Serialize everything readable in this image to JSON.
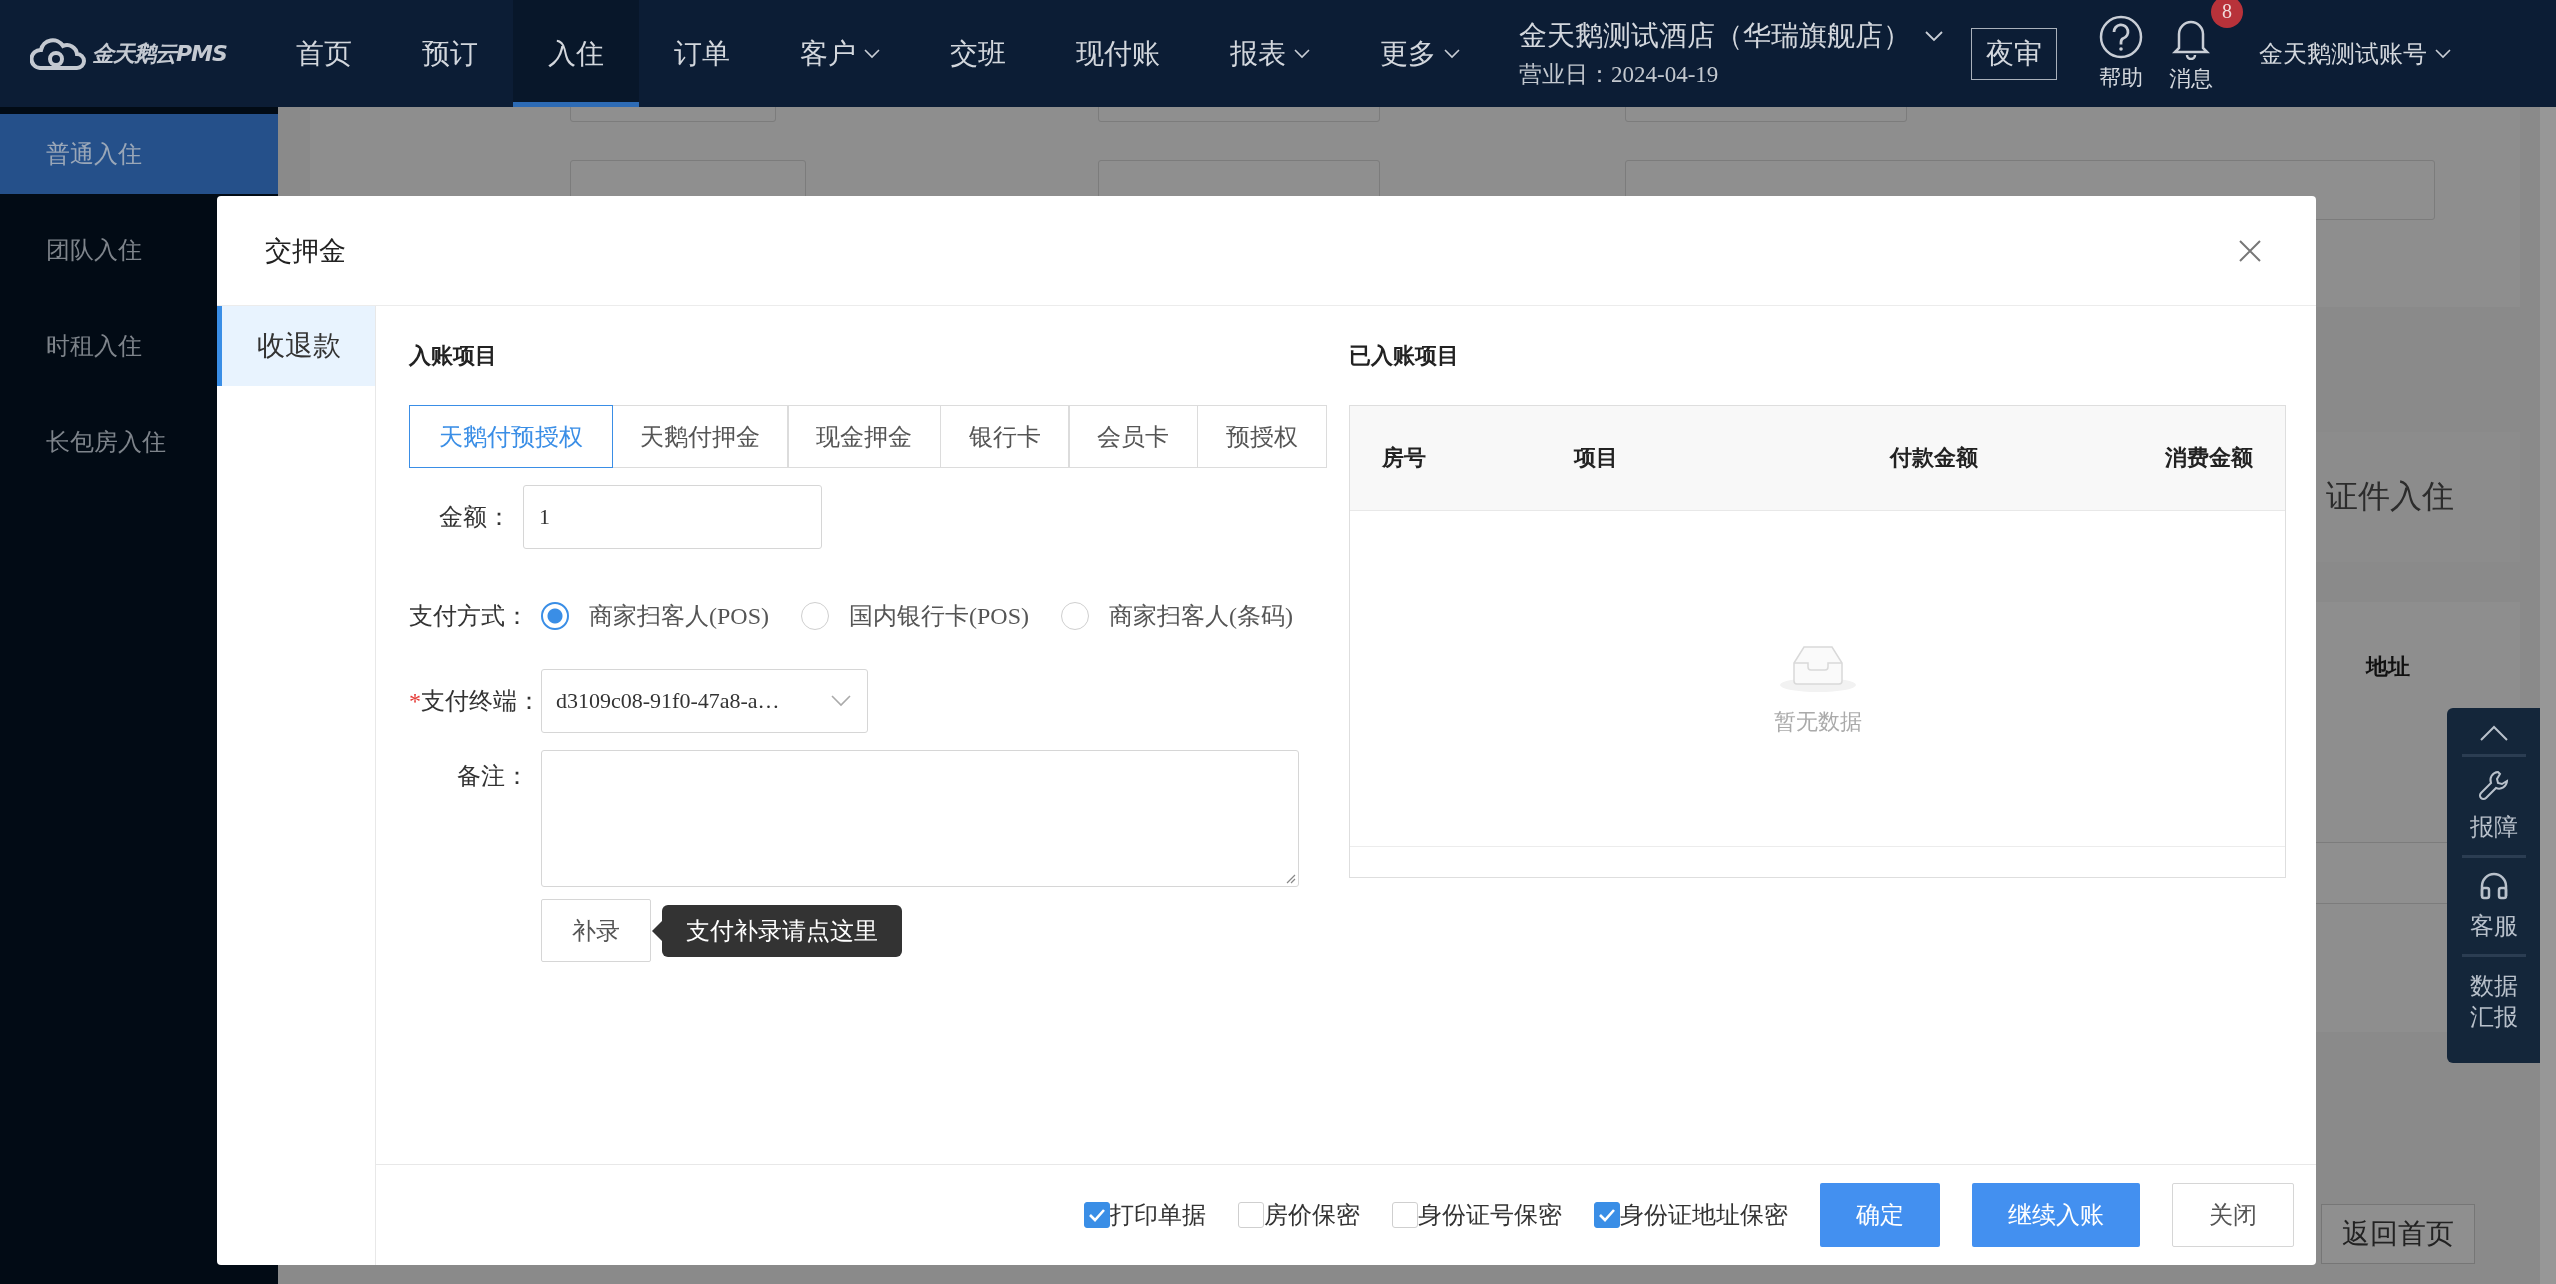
{
  "top_nav": {
    "logo": "金天鹅云PMS",
    "items": [
      {
        "label": "首页",
        "selected": false,
        "dropdown": false
      },
      {
        "label": "预订",
        "selected": false,
        "dropdown": false
      },
      {
        "label": "入住",
        "selected": true,
        "dropdown": false
      },
      {
        "label": "订单",
        "selected": false,
        "dropdown": false
      },
      {
        "label": "客户",
        "selected": false,
        "dropdown": true
      },
      {
        "label": "交班",
        "selected": false,
        "dropdown": false
      },
      {
        "label": "现付账",
        "selected": false,
        "dropdown": false
      },
      {
        "label": "报表",
        "selected": false,
        "dropdown": true
      },
      {
        "label": "更多",
        "selected": false,
        "dropdown": true
      }
    ],
    "hotel": {
      "name": "金天鹅测试酒店（华瑞旗舰店）",
      "business_day": "营业日：2024-04-19"
    },
    "night_audit_button": "夜审",
    "help": "帮助",
    "messages": {
      "label": "消息",
      "badge": "8"
    },
    "account": "金天鹅测试账号"
  },
  "sidebar": {
    "items": [
      {
        "label": "普通入住",
        "selected": true
      },
      {
        "label": "团队入住",
        "selected": false
      },
      {
        "label": "时租入住",
        "selected": false
      },
      {
        "label": "长包房入住",
        "selected": false
      }
    ]
  },
  "background_page": {
    "id_checkin_label": "证件入住",
    "address_header": "地址",
    "home_button": "返回首页"
  },
  "dialog": {
    "title": "交押金",
    "side_tabs": [
      {
        "label": "收退款",
        "selected": true
      }
    ],
    "left_section_title": "入账项目",
    "payment_tabs": [
      {
        "label": "天鹅付预授权",
        "selected": true
      },
      {
        "label": "天鹅付押金",
        "selected": false
      },
      {
        "label": "现金押金",
        "selected": false
      },
      {
        "label": "银行卡",
        "selected": false
      },
      {
        "label": "会员卡",
        "selected": false
      },
      {
        "label": "预授权",
        "selected": false
      }
    ],
    "amount": {
      "label": "金额：",
      "value": "1"
    },
    "payment_method": {
      "label": "支付方式：",
      "options": [
        {
          "label": "商家扫客人(POS)",
          "selected": true
        },
        {
          "label": "国内银行卡(POS)",
          "selected": false
        },
        {
          "label": "商家扫客人(条码)",
          "selected": false
        }
      ]
    },
    "terminal": {
      "required_mark": "*",
      "label": "支付终端：",
      "value": "d3109c08-91f0-47a8-a…"
    },
    "note": {
      "label": "备注："
    },
    "supplement_button": "补录",
    "tooltip": "支付补录请点这里",
    "right_section_title": "已入账项目",
    "table": {
      "columns": [
        "房号",
        "项目",
        "付款金额",
        "消费金额"
      ],
      "empty_text": "暂无数据"
    },
    "options": [
      {
        "label": "打印单据",
        "checked": true
      },
      {
        "label": "房价保密",
        "checked": false
      },
      {
        "label": "身份证号保密",
        "checked": false
      },
      {
        "label": "身份证地址保密",
        "checked": true
      }
    ],
    "buttons": [
      {
        "label": "确定",
        "kind": "primary"
      },
      {
        "label": "继续入账",
        "kind": "primary"
      },
      {
        "label": "关闭",
        "kind": "default"
      }
    ]
  },
  "float_panel": {
    "items": [
      {
        "kind": "top"
      },
      {
        "kind": "wrench",
        "label": "报障"
      },
      {
        "kind": "headset",
        "label": "客服"
      },
      {
        "kind": "text",
        "label": "数据汇报"
      }
    ]
  }
}
